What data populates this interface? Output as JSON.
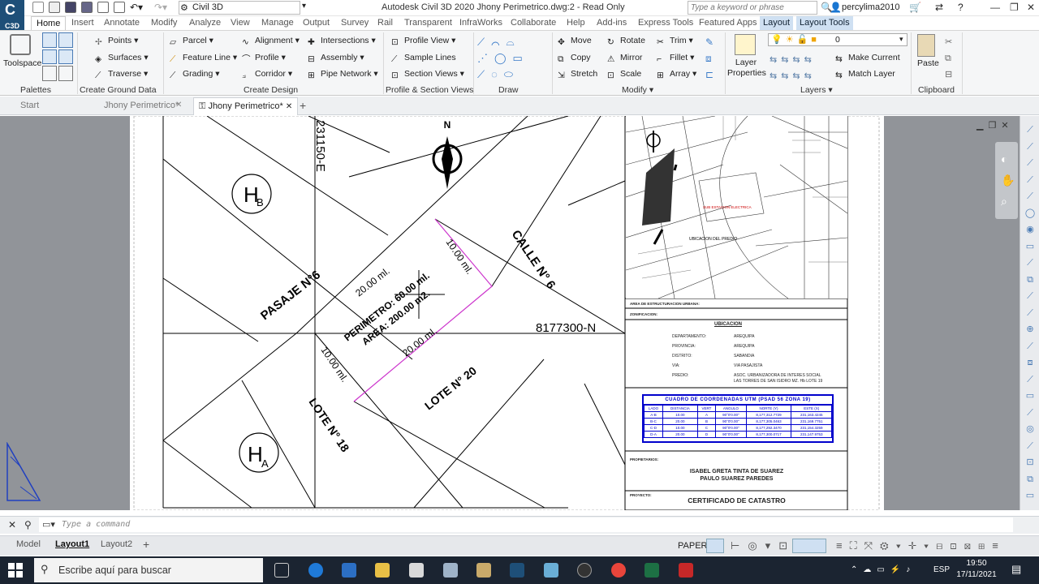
{
  "app": {
    "logo_text": "C3D",
    "workspace": "Civil 3D",
    "title": "Autodesk Civil 3D 2020   Jhony Perimetrico.dwg:2 - Read Only",
    "search_placeholder": "Type a keyword or phrase",
    "user": "percylima2010"
  },
  "ribbon_tabs": [
    "Home",
    "Insert",
    "Annotate",
    "Modify",
    "Analyze",
    "View",
    "Manage",
    "Output",
    "Survey",
    "Rail",
    "Transparent",
    "InfraWorks",
    "Collaborate",
    "Help",
    "Add-ins",
    "Express Tools",
    "Featured Apps",
    "Layout",
    "Layout Tools"
  ],
  "ribbon": {
    "toolspace": "Toolspace",
    "palettes": "Palettes",
    "ground": {
      "points": "Points",
      "surfaces": "Surfaces",
      "traverse": "Traverse",
      "panel": "Create Ground Data"
    },
    "design": {
      "parcel": "Parcel",
      "feature_line": "Feature Line",
      "grading": "Grading",
      "alignment": "Alignment",
      "profile": "Profile",
      "corridor": "Corridor",
      "intersections": "Intersections",
      "assembly": "Assembly",
      "pipe_network": "Pipe Network",
      "panel": "Create Design"
    },
    "views": {
      "profile_view": "Profile View",
      "sample_lines": "Sample Lines",
      "section_views": "Section Views",
      "panel": "Profile & Section Views"
    },
    "draw": {
      "panel": "Draw"
    },
    "modify": {
      "move": "Move",
      "copy": "Copy",
      "stretch": "Stretch",
      "rotate": "Rotate",
      "mirror": "Mirror",
      "scale": "Scale",
      "trim": "Trim",
      "fillet": "Fillet",
      "array": "Array",
      "panel": "Modify"
    },
    "layers": {
      "layer_properties": "Layer Properties",
      "current_layer": "0",
      "make_current": "Make Current",
      "match_layer": "Match Layer",
      "panel": "Layers"
    },
    "clipboard": {
      "paste": "Paste",
      "panel": "Clipboard"
    }
  },
  "doc_tabs": [
    "Start",
    "Jhony Perimetrico*",
    "Jhony Perimetrico*"
  ],
  "drawing": {
    "north": "N",
    "hb_main": "H",
    "hb_sub": "B",
    "ha_main": "H",
    "ha_sub": "A",
    "coord_e": "231150-E",
    "coord_n": "8177300-N",
    "pasaje": "PASAJE N°6",
    "calle": "CALLE N° 6",
    "lote20": "LOTE N° 20",
    "lote18": "LOTE N° 18",
    "dim_top_left": "20.00 ml.",
    "dim_top_right": "10.00 ml.",
    "dim_bottom_right": "20.00 ml.",
    "dim_bottom_left": "10.00 ml.",
    "perimetro": "PERIMETRO: 60.00 ml.",
    "area": "AREA: 200.00 m2."
  },
  "title_block": {
    "area_row": "AREA DE ESTRUCTURACION URBANA:",
    "zonificacion": "ZONIFICACION:",
    "ubicacion_header": "UBICACION",
    "dep_label": "DEPARTAMENTO:",
    "dep_value": "AREQUIPA",
    "prov_label": "PROVINCIA:",
    "prov_value": "AREQUIPA",
    "dist_label": "DISTRITO:",
    "dist_value": "SABANDIA",
    "via_label": "VIA:",
    "via_value": "VIA PASAJISTA",
    "predio_label": "PREDIO:",
    "predio_value_1": "ASOC. URBANIZADORA DE INTERES SOCIAL",
    "predio_value_2": "LAS TORRES DE SAN ISIDRO MZ. Hb LOTE 19",
    "coord_title": "CUADRO DE COORDENADAS UTM (PSAD 56 ZONA 19)",
    "coord_headers": [
      "LADO",
      "DISTANCIA",
      "VERT",
      "ANGULO",
      "NORTE (Y)",
      "ESTE (X)"
    ],
    "coord_rows": [
      [
        "A-B",
        "10.00",
        "A",
        "90°0'0.00\"",
        "8,177,312.7729",
        "231,163.4245"
      ],
      [
        "B-C",
        "20.00",
        "B",
        "90°0'0.00\"",
        "8,177,305.0463",
        "231,169.7751"
      ],
      [
        "C-D",
        "10.00",
        "C",
        "90°0'0.00\"",
        "8,177,292.3470",
        "231,154.3259"
      ],
      [
        "D-A",
        "20.00",
        "D",
        "90°0'0.00\"",
        "8,177,300.0717",
        "231,147.9753"
      ]
    ],
    "propietario_label": "PROPIETARIOS:",
    "owner_1": "ISABEL GRETA TINTA DE SUAREZ",
    "owner_2": "PAULO SUAREZ PAREDES",
    "proyecto_label": "PROYECTO:",
    "proyecto_value": "CERTIFICADO DE CATASTRO",
    "map_label_1": "UBICACION DEL PREDIO",
    "map_label_2": "SUB ESTACION ELECTRICA"
  },
  "command": {
    "placeholder": "Type a command"
  },
  "layout_tabs": [
    "Model",
    "Layout1",
    "Layout2"
  ],
  "status": {
    "space": "PAPER"
  },
  "taskbar": {
    "search": "Escribe aquí para buscar",
    "lang": "ESP",
    "time": "19:50",
    "date": "17/11/2021"
  },
  "colors": {
    "title_blue": "#1e4f78",
    "accent_blue": "#0000cc",
    "magenta": "#cc33cc",
    "taskbar": "#1b2431"
  }
}
